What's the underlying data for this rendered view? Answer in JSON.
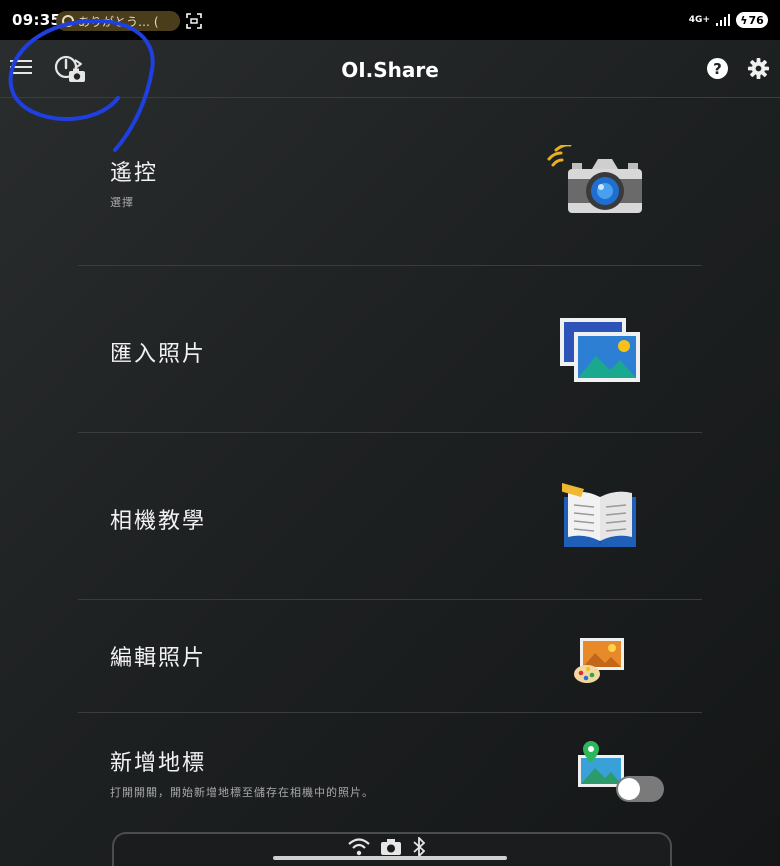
{
  "status_bar": {
    "time": "09:35",
    "notification_text": "ありがとう… (",
    "network": "4G+",
    "battery": "76"
  },
  "app_bar": {
    "title": "OI.Share",
    "help_label": "?"
  },
  "menu": [
    {
      "title": "遙控",
      "subtitle": "選擇",
      "icon": "remote-camera-icon"
    },
    {
      "title": "匯入照片",
      "subtitle": "",
      "icon": "import-photos-icon"
    },
    {
      "title": "相機教學",
      "subtitle": "",
      "icon": "camera-guide-book-icon"
    },
    {
      "title": "編輯照片",
      "subtitle": "",
      "icon": "edit-photo-palette-icon"
    },
    {
      "title": "新增地標",
      "subtitle": "打開開關，開始新增地標至儲存在相機中的照片。",
      "icon": "geotag-photo-icon"
    }
  ],
  "geotag_toggle": {
    "on": false
  },
  "colors": {
    "annotation_stroke": "#1f3fe0",
    "accent_blue": "#1f6fd0",
    "background": "#1e2122"
  }
}
